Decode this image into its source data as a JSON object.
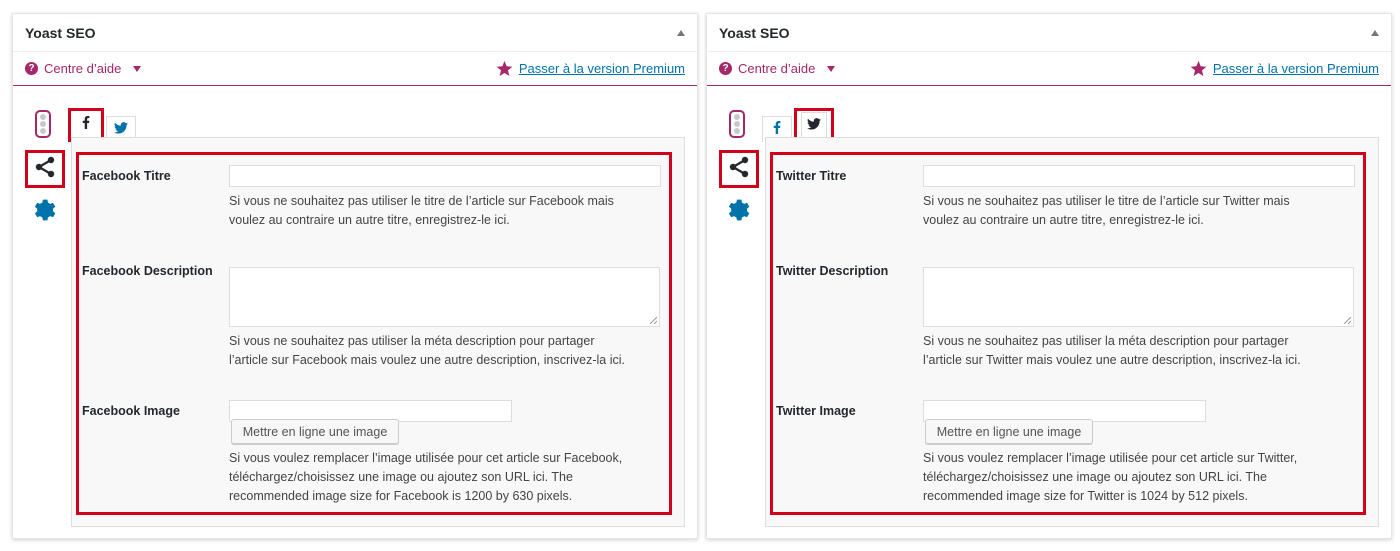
{
  "panels": [
    {
      "title": "Yoast SEO",
      "help_label": "Centre d’aide",
      "premium_label": "Passer à la version Premium",
      "title_label": "Facebook Titre",
      "title_help": [
        "Si vous ne souhaitez pas utiliser le titre de l’article sur Facebook mais",
        "voulez au contraire un autre titre, enregistrez-le ici."
      ],
      "description_label": "Facebook Description",
      "description_help": [
        "Si vous ne souhaitez pas utiliser la méta description pour partager",
        "l’article sur Facebook mais voulez une autre description, inscrivez-la ici."
      ],
      "image_label": "Facebook Image",
      "upload_label": "Mettre en ligne une image",
      "image_help": [
        "Si vous voulez remplacer l’image utilisée pour cet article sur Facebook,",
        "téléchargez/choisissez une image ou ajoutez son URL ici. The",
        "recommended image size for Facebook is 1200 by 630 pixels."
      ],
      "active_tab": "facebook"
    },
    {
      "title": "Yoast SEO",
      "help_label": "Centre d’aide",
      "premium_label": "Passer à la version Premium",
      "title_label": "Twitter Titre",
      "title_help": [
        "Si vous ne souhaitez pas utiliser le titre de l’article sur Twitter mais",
        "voulez au contraire un autre titre, enregistrez-le ici."
      ],
      "description_label": "Twitter Description",
      "description_help": [
        "Si vous ne souhaitez pas utiliser la méta description pour partager",
        "l’article sur Twitter mais voulez une autre description, inscrivez-la ici."
      ],
      "image_label": "Twitter Image",
      "upload_label": "Mettre en ligne une image",
      "image_help": [
        "Si vous voulez remplacer l’image utilisée pour cet article sur Twitter,",
        "téléchargez/choisissez une image ou ajoutez son URL ici. The",
        "recommended image size for Twitter is 1024 by 512 pixels."
      ],
      "active_tab": "twitter"
    }
  ],
  "icons": {
    "help": "question-circle-icon",
    "premium": "star-icon",
    "readability": "traffic-light-icon",
    "social": "share-icon",
    "settings": "gear-icon",
    "facebook": "facebook-icon",
    "twitter": "twitter-icon"
  },
  "colors": {
    "accent": "#a4286a",
    "link": "#0073aa",
    "highlight": "#d0021b",
    "icon_blue": "#0073aa"
  }
}
